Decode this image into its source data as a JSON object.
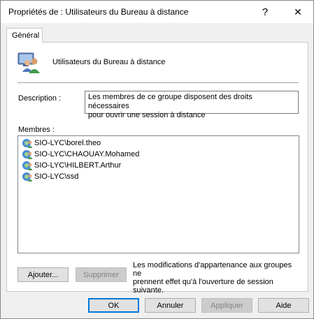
{
  "window": {
    "title": "Propriétés de : Utilisateurs du Bureau à distance",
    "help_label": "?",
    "close_label": "✕"
  },
  "tabs": [
    {
      "label": "Général",
      "active": true
    }
  ],
  "group": {
    "name": "Utilisateurs du Bureau à distance",
    "icon": "users-group-icon"
  },
  "description": {
    "label": "Description :",
    "line1": "Les membres de ce groupe disposent des droits nécessaires",
    "line2": "pour ouvrir une session à distance"
  },
  "members": {
    "label": "Membres :",
    "items": [
      {
        "name": "SIO-LYC\\borel.theo",
        "icon": "user-account-icon"
      },
      {
        "name": "SIO-LYC\\CHAOUAY.Mohamed",
        "icon": "user-account-icon"
      },
      {
        "name": "SIO-LYC\\HILBERT.Arthur",
        "icon": "user-account-icon"
      },
      {
        "name": "SIO-LYC\\ssd",
        "icon": "user-account-icon"
      }
    ]
  },
  "actions": {
    "add_label": "Ajouter...",
    "remove_label": "Supprimer"
  },
  "note": {
    "line1": "Les modifications d'appartenance aux groupes ne",
    "line2": "prennent effet qu'à l'ouverture de session",
    "line3": "suivante."
  },
  "footer": {
    "ok_label": "OK",
    "cancel_label": "Annuler",
    "apply_label": "Appliquer",
    "help_label": "Aide"
  },
  "colors": {
    "accent": "#0078d7",
    "dialog_bg": "#f0f0f0",
    "button_bg": "#e1e1e1"
  }
}
